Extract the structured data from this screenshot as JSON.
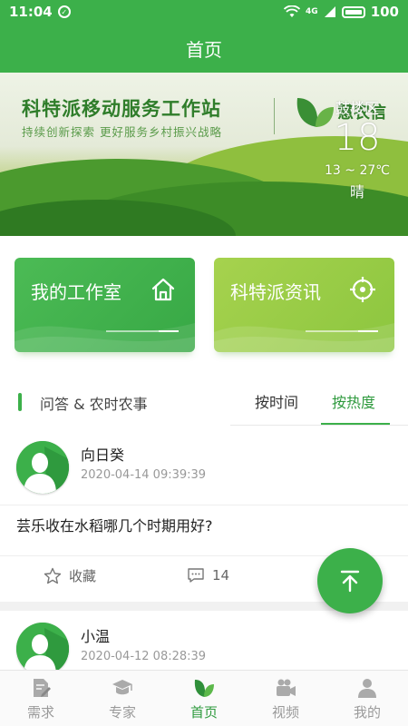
{
  "status_bar": {
    "time": "11:04",
    "network": "4G",
    "battery": "100"
  },
  "header": {
    "title": "首页"
  },
  "banner": {
    "title": "科特派移动服务工作站",
    "subtitle": "持续创新探索 更好服务乡村振兴战略",
    "logo_text": "慧农信",
    "weather": {
      "district": "鼓楼区",
      "temperature": "18",
      "range": "13 ~ 27℃",
      "condition": "晴"
    }
  },
  "cards": [
    {
      "label": "我的工作室",
      "icon": "home-icon",
      "color": "#3cb04a"
    },
    {
      "label": "科特派资讯",
      "icon": "target-icon",
      "color": "#9dcd48"
    }
  ],
  "section": {
    "title": "问答 & 农时农事",
    "tabs": [
      "按时间",
      "按热度"
    ],
    "active_tab": "按热度"
  },
  "posts": [
    {
      "author": "向日癸",
      "time": "2020-04-14 09:39:39",
      "question": "芸乐收在水稻哪几个时期用好?",
      "favorite_label": "收藏",
      "comment_count": "14"
    },
    {
      "author": "小温",
      "time": "2020-04-12 08:28:39"
    }
  ],
  "bottom_nav": [
    {
      "label": "需求",
      "icon": "document-edit-icon"
    },
    {
      "label": "专家",
      "icon": "graduation-cap-icon"
    },
    {
      "label": "首页",
      "icon": "leaf-icon",
      "active": true
    },
    {
      "label": "视频",
      "icon": "video-camera-icon"
    },
    {
      "label": "我的",
      "icon": "user-icon"
    }
  ],
  "colors": {
    "primary": "#3cb04a",
    "accent_light": "#9dcd48",
    "text_muted": "#999999"
  }
}
